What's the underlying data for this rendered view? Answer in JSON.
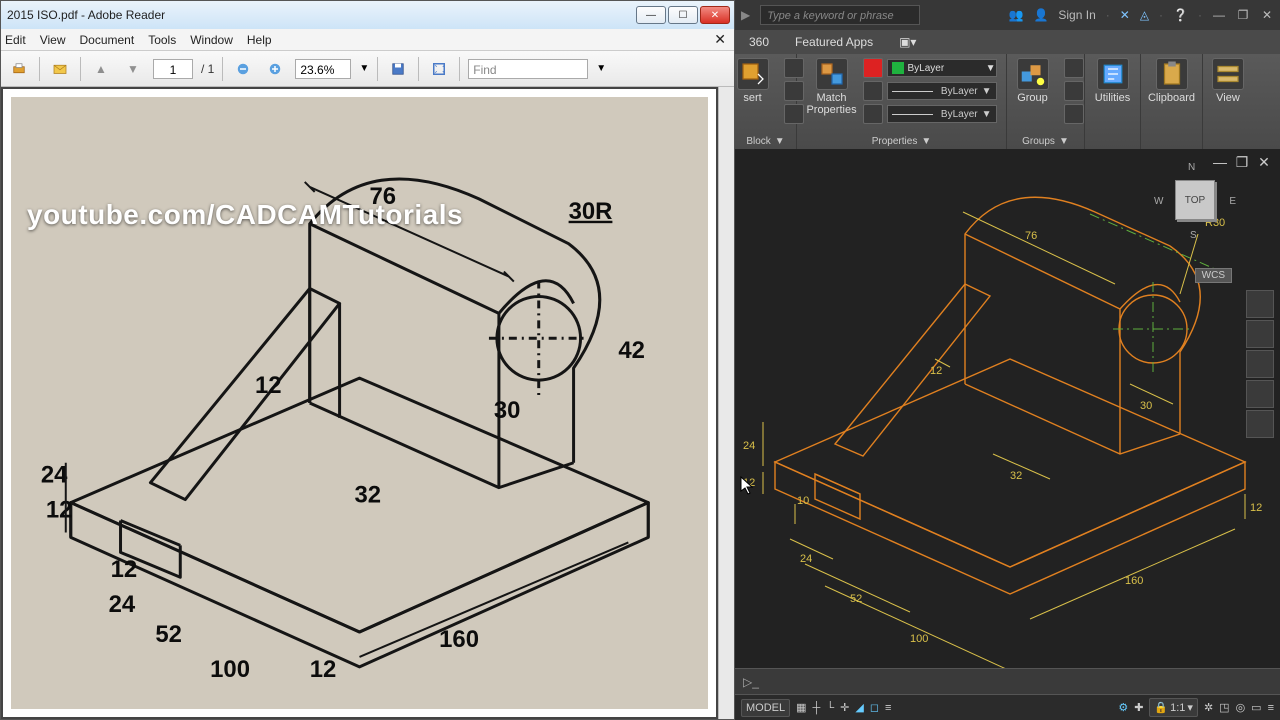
{
  "reader": {
    "title": "2015 ISO.pdf - Adobe Reader",
    "menu": [
      "Edit",
      "View",
      "Document",
      "Tools",
      "Window",
      "Help"
    ],
    "page_current": "1",
    "page_total": "/ 1",
    "zoom": "23.6%",
    "find_placeholder": "Find",
    "watermark": "youtube.com/CADCAMTutorials",
    "drawing_dims": {
      "d76": "76",
      "d30r": "30R",
      "d42": "42",
      "d30": "30",
      "d12a": "12",
      "d32": "32",
      "d24": "24",
      "d12b": "12",
      "d12c": "12",
      "d24b": "24",
      "d52": "52",
      "d100": "100",
      "d12d": "12",
      "d160": "160"
    }
  },
  "acad": {
    "search_placeholder": "Type a keyword or phrase",
    "signin": "Sign In",
    "tabs": {
      "a": "360",
      "b": "Featured Apps"
    },
    "panels": {
      "insert": "sert",
      "block": "Block",
      "match": "Match Properties",
      "properties": "Properties",
      "bylayer": "ByLayer",
      "group": "Group",
      "groups": "Groups",
      "utilities": "Utilities",
      "clipboard": "Clipboard",
      "view": "View"
    },
    "viewcube": {
      "face": "TOP",
      "n": "N",
      "e": "E",
      "s": "S",
      "w": "W",
      "wcs": "WCS"
    },
    "cad_dims": {
      "d76": "76",
      "dr30": "R30",
      "d30": "30",
      "d12": "12",
      "d32": "32",
      "d24": "24",
      "d12b": "12",
      "d10": "10",
      "d24b": "24",
      "d52": "52",
      "d100": "100",
      "d160": "160",
      "d12c": "12"
    },
    "status": {
      "model": "MODEL",
      "scale": "1:1"
    }
  }
}
